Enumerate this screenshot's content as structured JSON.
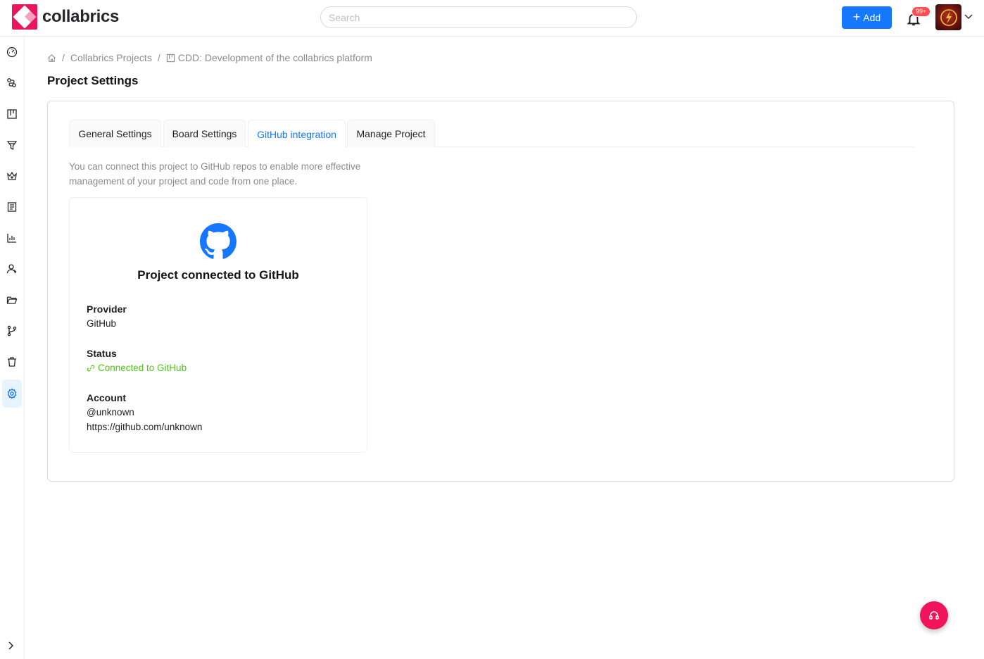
{
  "brand": {
    "name": "collabrics",
    "color": "#e8175d"
  },
  "header": {
    "search_placeholder": "Search",
    "add_label": "Add",
    "notifications_badge": "99+"
  },
  "sidebar": {
    "items": [
      {
        "icon": "dashboard-icon"
      },
      {
        "icon": "workflow-icon"
      },
      {
        "icon": "board-icon"
      },
      {
        "icon": "filter-icon"
      },
      {
        "icon": "crown-icon"
      },
      {
        "icon": "list-icon"
      },
      {
        "icon": "chart-icon"
      },
      {
        "icon": "users-icon"
      },
      {
        "icon": "folder-icon"
      },
      {
        "icon": "branch-icon"
      },
      {
        "icon": "trash-icon"
      },
      {
        "icon": "settings-icon",
        "active": true
      }
    ]
  },
  "breadcrumb": {
    "level1": "Collabrics Projects",
    "level2": "CDD: Development of the collabrics platform",
    "separator": "/"
  },
  "page": {
    "title": "Project Settings"
  },
  "tabs": [
    {
      "label": "General Settings"
    },
    {
      "label": "Board Settings"
    },
    {
      "label": "GitHub integration",
      "active": true
    },
    {
      "label": "Manage Project"
    }
  ],
  "github": {
    "intro": "You can connect this project to GitHub repos to enable more effective management of your project and code from one place.",
    "card_title": "Project connected to GitHub",
    "provider_label": "Provider",
    "provider_value": "GitHub",
    "status_label": "Status",
    "status_value": "Connected to GitHub",
    "account_label": "Account",
    "account_handle": "@unknown",
    "account_url": "https://github.com/unknown"
  },
  "colors": {
    "accent": "#1677ff",
    "success": "#52c41a",
    "fab": "#f0145a"
  }
}
